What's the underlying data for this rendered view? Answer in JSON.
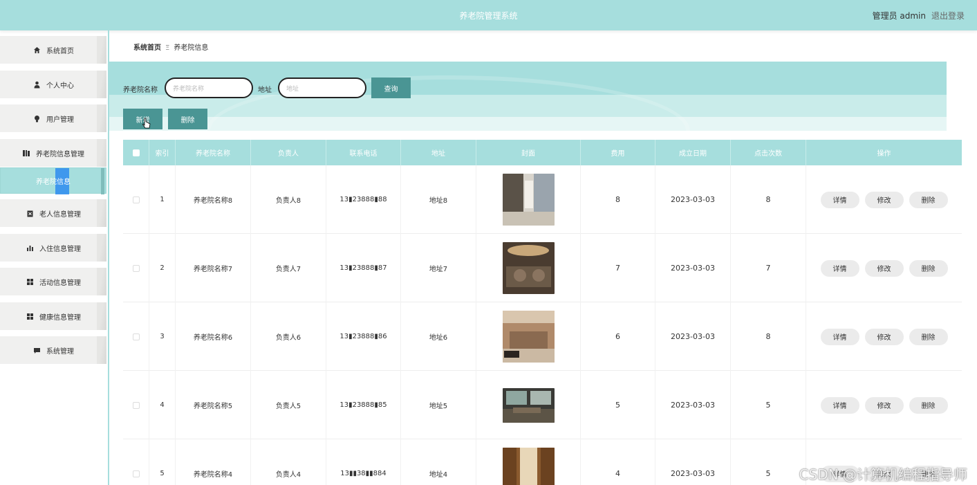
{
  "header": {
    "title": "养老院管理系统",
    "user": "管理员 admin",
    "logout": "退出登录"
  },
  "sidebar": {
    "items": [
      {
        "label": "系统首页",
        "icon": "home-icon"
      },
      {
        "label": "个人中心",
        "icon": "person-icon"
      },
      {
        "label": "用户管理",
        "icon": "bulb-icon"
      },
      {
        "label": "养老院信息管理",
        "icon": "book-icon"
      },
      {
        "label": "养老院信息",
        "icon": ""
      },
      {
        "label": "老人信息管理",
        "icon": "clipboard-icon"
      },
      {
        "label": "入住信息管理",
        "icon": "bar-chart-icon"
      },
      {
        "label": "活动信息管理",
        "icon": "grid-icon"
      },
      {
        "label": "健康信息管理",
        "icon": "grid-icon"
      },
      {
        "label": "系统管理",
        "icon": "message-icon"
      }
    ]
  },
  "breadcrumb": {
    "home": "系统首页",
    "separator": "Ξ",
    "current": "养老院信息"
  },
  "search": {
    "name_label": "养老院名称",
    "name_placeholder": "养老院名称",
    "address_label": "地址",
    "address_placeholder": "地址",
    "query": "查询",
    "add": "新增",
    "delete": "删除"
  },
  "table": {
    "headers": [
      "索引",
      "养老院名称",
      "负责人",
      "联系电话",
      "地址",
      "封面",
      "费用",
      "成立日期",
      "点击次数",
      "操作"
    ],
    "actions": [
      "详情",
      "修改",
      "删除"
    ],
    "rows": [
      {
        "index": "1",
        "name": "养老院名称8",
        "manager": "负责人8",
        "phone": "13▮23888▮88",
        "address": "地址8",
        "fee": "8",
        "date": "2023-03-03",
        "clicks": "8"
      },
      {
        "index": "2",
        "name": "养老院名称7",
        "manager": "负责人7",
        "phone": "13▮23888▮87",
        "address": "地址7",
        "fee": "7",
        "date": "2023-03-03",
        "clicks": "7"
      },
      {
        "index": "3",
        "name": "养老院名称6",
        "manager": "负责人6",
        "phone": "13▮23888▮86",
        "address": "地址6",
        "fee": "6",
        "date": "2023-03-03",
        "clicks": "8"
      },
      {
        "index": "4",
        "name": "养老院名称5",
        "manager": "负责人5",
        "phone": "13▮23888▮85",
        "address": "地址5",
        "fee": "5",
        "date": "2023-03-03",
        "clicks": "5"
      },
      {
        "index": "5",
        "name": "养老院名称4",
        "manager": "负责人4",
        "phone": "13▮▮38▮▮884",
        "address": "地址4",
        "fee": "4",
        "date": "2023-03-03",
        "clicks": "5"
      }
    ]
  },
  "watermark": "CSDN @计算机编程指导师",
  "colors": {
    "primary": "#a6dedd",
    "button": "#4a9594",
    "highlight": "#2d8cf0"
  }
}
